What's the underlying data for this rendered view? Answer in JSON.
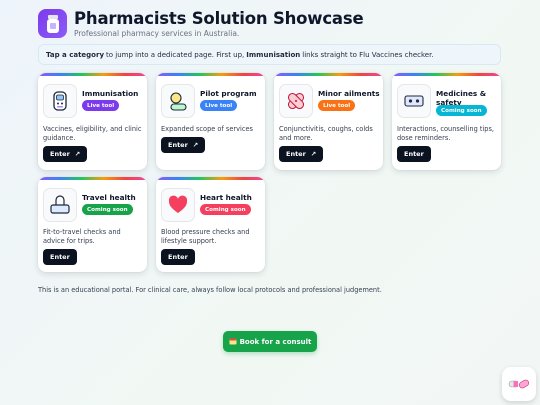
{
  "header": {
    "title": "Pharmacists Solution Showcase",
    "subtitle": "Professional pharmacy services in Australia.",
    "logo_icon": "pill-bottle-icon"
  },
  "notice": {
    "prefix": "Tap a category",
    "middle": "to jump into a dedicated page. First up,",
    "highlight": "Immunisation",
    "suffix": "links straight to Flu Vaccines checker."
  },
  "cards": [
    {
      "title": "Immunisation",
      "badge": "Live tool",
      "badge_color": "#7c3aed",
      "description": "Vaccines, eligibility, and clinic guidance.",
      "button": "Enter",
      "button_icon": "arrow-up-right-icon",
      "icon": "syringe-robot-icon"
    },
    {
      "title": "Pilot program",
      "badge": "Live tool",
      "badge_color": "#3b82f6",
      "description": "Expanded scope of services",
      "button": "Enter",
      "button_icon": "arrow-up-right-icon",
      "icon": "user-icon"
    },
    {
      "title": "Minor ailments",
      "badge": "Live tool",
      "badge_color": "#f97316",
      "description": "Conjunctivitis, coughs, colds and more.",
      "button": "Enter",
      "button_icon": "arrow-up-right-icon",
      "icon": "bandage-icon"
    },
    {
      "title": "Medicines & safety",
      "badge": "Coming soon",
      "badge_color": "#06b6d4",
      "description": "Interactions, counselling tips, dose reminders.",
      "button": "Enter",
      "icon": "pill-box-icon"
    },
    {
      "title": "Travel health",
      "badge": "Coming soon",
      "badge_color": "#16a34a",
      "description": "Fit-to-travel checks and advice for trips.",
      "button": "Enter",
      "icon": "suitcase-icon"
    },
    {
      "title": "Heart health",
      "badge": "Coming soon",
      "badge_color": "#f43f5e",
      "description": "Blood pressure checks and lifestyle support.",
      "button": "Enter",
      "icon": "heart-icon"
    }
  ],
  "disclaimer": "This is an educational portal. For clinical care, always follow local protocols and professional judgement.",
  "book_button": {
    "label": "Book for a consult",
    "icon": "calendar-icon"
  },
  "fab": {
    "icon": "pills-icon"
  }
}
